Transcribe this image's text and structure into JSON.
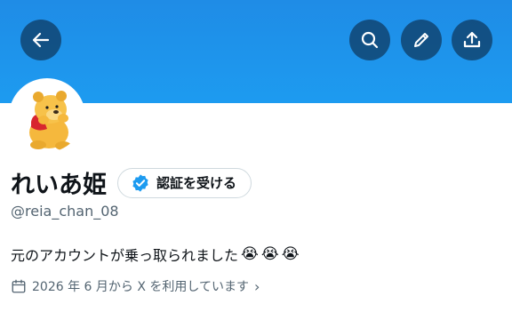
{
  "header": {
    "back_icon": "arrow-left-icon",
    "search_icon": "search-icon",
    "edit_icon": "pencil-icon",
    "share_icon": "share-upload-icon",
    "banner_color": "#1d9bf0"
  },
  "profile": {
    "display_name": "れいあ姫",
    "verify_button_label": "認証を受ける",
    "verify_icon": "verified-badge-icon",
    "handle": "@reia_chan_08",
    "bio_text": "元のアカウントが乗っ取られました",
    "bio_emojis": [
      "😭",
      "😭",
      "😭"
    ],
    "joined_text": "2026 年 6 月から X を利用しています",
    "joined_icon": "calendar-icon"
  },
  "colors": {
    "accent_blue": "#1d9bf0",
    "text_primary": "#0f1419",
    "text_secondary": "#536471"
  }
}
